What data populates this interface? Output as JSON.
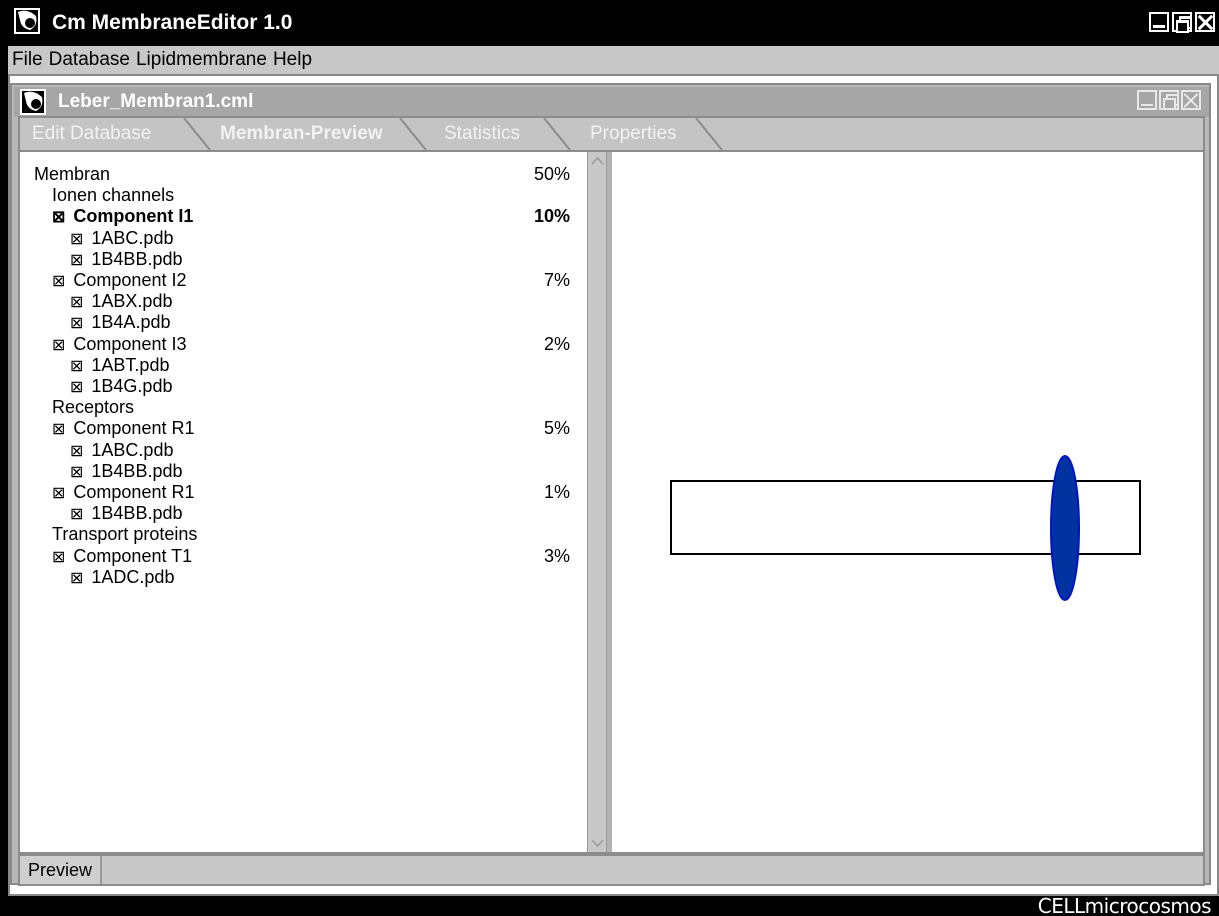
{
  "window": {
    "title": "Cm MembraneEditor 1.0",
    "icon": "cell-icon"
  },
  "menu": {
    "items": [
      "File",
      "Database",
      "Lipidmembrane",
      "Help"
    ]
  },
  "document": {
    "title": "Leber_Membran1.cml",
    "icon": "cell-icon"
  },
  "tabs": [
    {
      "label": "Edit Database",
      "active": false
    },
    {
      "label": "Membran-Preview",
      "active": true
    },
    {
      "label": "Statistics",
      "active": false
    },
    {
      "label": "Properties",
      "active": false
    }
  ],
  "tree": [
    {
      "label": "Membran",
      "pct": "50%",
      "level": 0,
      "checkbox": false,
      "bold": false
    },
    {
      "label": "Ionen channels",
      "pct": "",
      "level": 1,
      "checkbox": false,
      "bold": false
    },
    {
      "label": "Component I1",
      "pct": "10%",
      "level": 1,
      "checkbox": true,
      "bold": true
    },
    {
      "label": "1ABC.pdb",
      "pct": "",
      "level": 2,
      "checkbox": true,
      "bold": false
    },
    {
      "label": "1B4BB.pdb",
      "pct": "",
      "level": 2,
      "checkbox": true,
      "bold": false
    },
    {
      "label": "Component I2",
      "pct": "7%",
      "level": 1,
      "checkbox": true,
      "bold": false
    },
    {
      "label": "1ABX.pdb",
      "pct": "",
      "level": 2,
      "checkbox": true,
      "bold": false
    },
    {
      "label": "1B4A.pdb",
      "pct": "",
      "level": 2,
      "checkbox": true,
      "bold": false
    },
    {
      "label": "Component I3",
      "pct": "2%",
      "level": 1,
      "checkbox": true,
      "bold": false
    },
    {
      "label": "1ABT.pdb",
      "pct": "",
      "level": 2,
      "checkbox": true,
      "bold": false
    },
    {
      "label": "1B4G.pdb",
      "pct": "",
      "level": 2,
      "checkbox": true,
      "bold": false
    },
    {
      "label": "Receptors",
      "pct": "",
      "level": 1,
      "checkbox": false,
      "bold": false
    },
    {
      "label": "Component R1",
      "pct": "5%",
      "level": 1,
      "checkbox": true,
      "bold": false
    },
    {
      "label": "1ABC.pdb",
      "pct": "",
      "level": 2,
      "checkbox": true,
      "bold": false
    },
    {
      "label": "1B4BB.pdb",
      "pct": "",
      "level": 2,
      "checkbox": true,
      "bold": false
    },
    {
      "label": "Component R1",
      "pct": "1%",
      "level": 1,
      "checkbox": true,
      "bold": false
    },
    {
      "label": "1B4BB.pdb",
      "pct": "",
      "level": 2,
      "checkbox": true,
      "bold": false
    },
    {
      "label": "Transport proteins",
      "pct": "",
      "level": 1,
      "checkbox": false,
      "bold": false
    },
    {
      "label": "Component T1",
      "pct": "3%",
      "level": 1,
      "checkbox": true,
      "bold": false
    },
    {
      "label": "1ADC.pdb",
      "pct": "",
      "level": 2,
      "checkbox": true,
      "bold": false
    }
  ],
  "checkbox_glyph": "⊠",
  "status": {
    "label": "Preview"
  },
  "footer": {
    "logo": "CELLmicrocosmos"
  },
  "colors": {
    "protein_fill": "#0033a0",
    "protein_stroke": "#0014cc",
    "titlebar": "#000000",
    "frame_gray": "#b8b8b8"
  }
}
